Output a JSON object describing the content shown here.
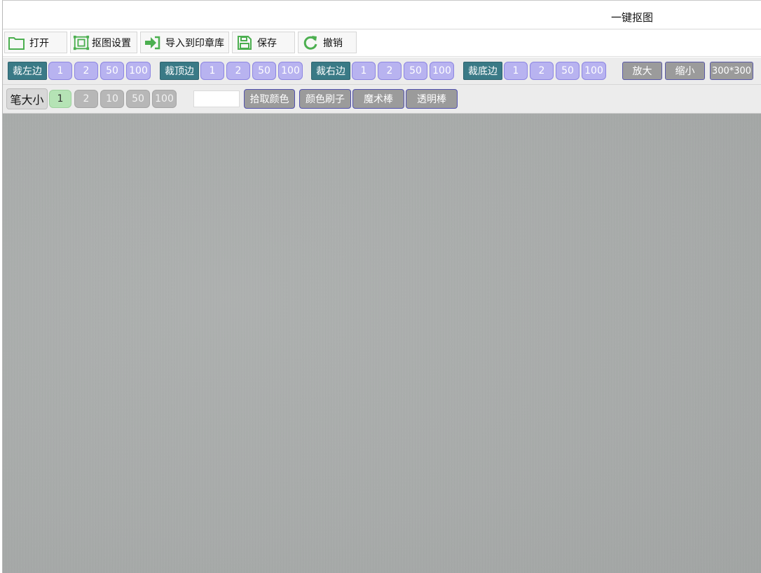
{
  "window": {
    "title": "一键抠图"
  },
  "toolbar": {
    "open_label": "打开",
    "matting_settings_label": "抠图设置",
    "import_label": "导入到印章库",
    "save_label": "保存",
    "undo_label": "撤销"
  },
  "crop": {
    "left": {
      "label": "裁左边",
      "steps": [
        "1",
        "2",
        "50",
        "100"
      ]
    },
    "top": {
      "label": "裁顶边",
      "steps": [
        "1",
        "2",
        "50",
        "100"
      ]
    },
    "right": {
      "label": "裁右边",
      "steps": [
        "1",
        "2",
        "50",
        "100"
      ]
    },
    "bottom": {
      "label": "裁底边",
      "steps": [
        "1",
        "2",
        "50",
        "100"
      ]
    },
    "zoom_in_label": "放大",
    "zoom_out_label": "缩小",
    "size_label": "300*300"
  },
  "brush": {
    "size_label": "笔大小",
    "sizes": [
      "1",
      "2",
      "10",
      "50",
      "100"
    ],
    "selected_size": "1",
    "pick_color_label": "拾取颜色",
    "color_brush_label": "颜色刷子",
    "magic_wand_label": "魔术棒",
    "transparent_wand_label": "透明棒"
  },
  "colors": {
    "crop_label_bg": "#3a7a86",
    "step_button_bg": "#b8b3f0",
    "tool_button_bg": "#9b9b9b",
    "selected_size_bg": "#b5e3b5",
    "canvas_bg": "#a8abaa",
    "icon_green": "#4caf50"
  }
}
